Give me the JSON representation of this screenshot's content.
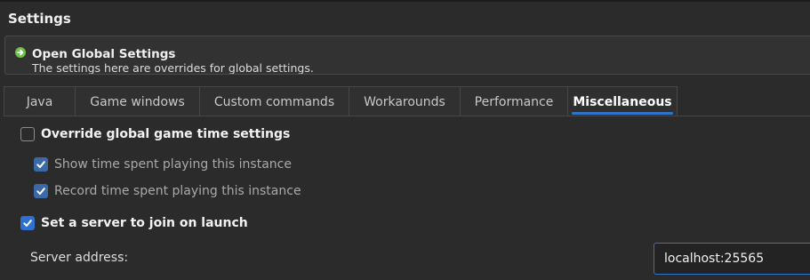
{
  "page": {
    "title": "Settings"
  },
  "notice": {
    "title": "Open Global Settings",
    "subtitle": "The settings here are overrides for global settings.",
    "icon": "arrow-right-icon",
    "icon_color": "#6cc04a"
  },
  "tabs": [
    {
      "label": "Java",
      "active": false
    },
    {
      "label": "Game windows",
      "active": false
    },
    {
      "label": "Custom commands",
      "active": false
    },
    {
      "label": "Workarounds",
      "active": false
    },
    {
      "label": "Performance",
      "active": false
    },
    {
      "label": "Miscellaneous",
      "active": true
    }
  ],
  "misc": {
    "override_game_time": {
      "label": "Override global game time settings",
      "checked": false
    },
    "show_time": {
      "label": "Show time spent playing this instance",
      "checked": true,
      "enabled": false
    },
    "record_time": {
      "label": "Record time spent playing this instance",
      "checked": true,
      "enabled": false
    },
    "join_server": {
      "label": "Set a server to join on launch",
      "checked": true
    },
    "server_address": {
      "label": "Server address:",
      "value": "localhost:25565"
    }
  },
  "colors": {
    "accent": "#2e6fd0",
    "background": "#2b2b2b"
  }
}
